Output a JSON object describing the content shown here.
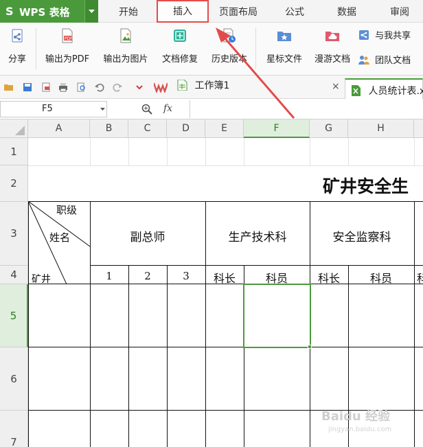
{
  "app": {
    "logo": "S",
    "name": "WPS 表格"
  },
  "menu_tabs": [
    "开始",
    "插入",
    "页面布局",
    "公式",
    "数据",
    "审阅"
  ],
  "ribbon": {
    "share": "分享",
    "export_pdf": "输出为PDF",
    "export_image": "输出为图片",
    "doc_repair": "文档修复",
    "history": "历史版本",
    "starred": "星标文件",
    "roaming": "漫游文档",
    "shared_with_me": "与我共享",
    "team_docs": "团队文档"
  },
  "doc_tabs": {
    "workbook": "工作簿1",
    "active": "人员统计表.x",
    "close": "×"
  },
  "formula_bar": {
    "name_box": "F5",
    "fx": "fx",
    "content": ""
  },
  "columns": [
    "A",
    "B",
    "C",
    "D",
    "E",
    "F",
    "G",
    "H"
  ],
  "rows": [
    "1",
    "2",
    "3",
    "4",
    "5",
    "6",
    "7"
  ],
  "selected": {
    "column": "F",
    "row": "5"
  },
  "sheet": {
    "title": "矿井安全生",
    "diag_top": "职级",
    "diag_mid": "姓名",
    "diag_bottom": "矿井",
    "group1": "副总师",
    "group2": "生产技术科",
    "group3": "安全监察科",
    "sub1": "1",
    "sub2": "2",
    "sub3": "3",
    "sub_e": "科长",
    "sub_f": "科员",
    "sub_g": "科长",
    "sub_h": "科员",
    "sub_i": "科"
  },
  "watermark": {
    "text": "Baidu 经验",
    "sub": "jingyan.baidu.com"
  },
  "colors": {
    "wps_green": "#4a9a3b",
    "annotation_red": "#e34b4b"
  }
}
